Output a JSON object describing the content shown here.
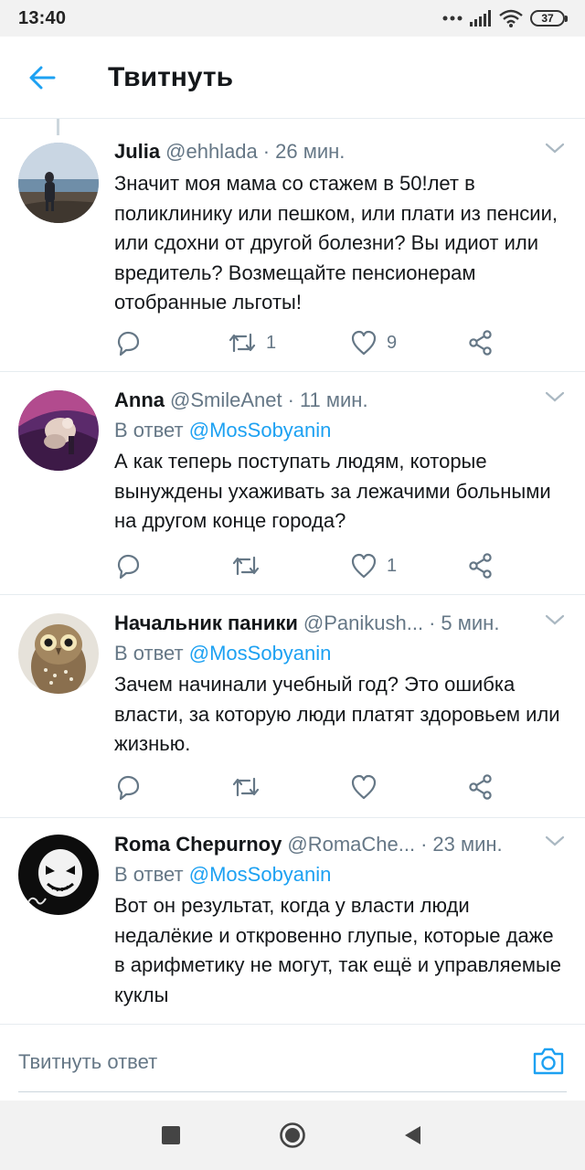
{
  "status_bar": {
    "time": "13:40",
    "battery": "37"
  },
  "header": {
    "title": "Твитнуть"
  },
  "tweets": [
    {
      "name": "Julia",
      "handle": "@ehhlada",
      "time": "26 мин.",
      "reply_prefix": "",
      "reply_to": "",
      "text": "Значит моя мама со стажем в 50!лет в поликлинику или пешком, или плати из пенсии, или сдохни от другой болезни? Вы идиот или вредитель? Возмещайте пенсионерам отобранные льготы!",
      "retweets": "1",
      "likes": "9"
    },
    {
      "name": "Anna",
      "handle": "@SmileAnet",
      "time": "11 мин.",
      "reply_prefix": "В ответ",
      "reply_to": "@MosSobyanin",
      "text": "А как теперь поступать людям, которые вынуждены ухаживать за лежачими больными на другом конце города?",
      "retweets": "",
      "likes": "1"
    },
    {
      "name": "Начальник паники",
      "handle": "@Panikush...",
      "time": "5 мин.",
      "reply_prefix": "В ответ",
      "reply_to": "@MosSobyanin",
      "text": "Зачем начинали учебный год? Это ошибка власти, за которую люди платят здоровьем или жизнью.",
      "retweets": "",
      "likes": ""
    },
    {
      "name": "Roma Chepurnoy",
      "handle": "@RomaChe...",
      "time": "23 мин.",
      "reply_prefix": "В ответ",
      "reply_to": "@MosSobyanin",
      "text": "Вот он результат, когда у власти люди недалёкие и откровенно глупые, которые даже в арифметику не могут, так ещё и управляемые куклы",
      "retweets": "",
      "likes": ""
    }
  ],
  "compose": {
    "placeholder": "Твитнуть ответ"
  },
  "icons": {
    "back": "back-arrow-icon",
    "chevron": "chevron-down-icon",
    "reply": "reply-icon",
    "retweet": "retweet-icon",
    "like": "heart-icon",
    "share": "share-icon",
    "camera": "camera-icon"
  },
  "colors": {
    "accent": "#1da1f2",
    "secondary_text": "#657786",
    "divider": "#e6ecf0"
  }
}
